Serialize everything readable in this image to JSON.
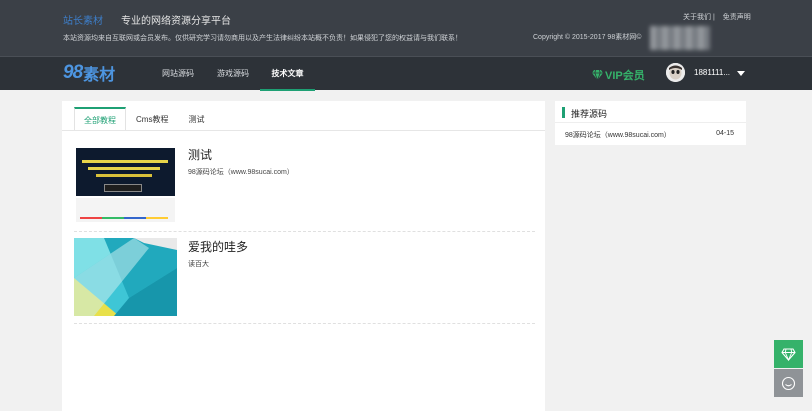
{
  "topbar": {
    "brand_mini": "站长素材",
    "slogan": "专业的网络资源分享平台",
    "notice": "本站资源均来自互联网或会员发布。仅供研究学习请勿商用以及产生法律纠纷本站概不负责！如果侵犯了您的权益请与我们联系！",
    "copyright": "Copyright © 2015-2017 98素材网©",
    "links": [
      "关于我们 |",
      "免责声明"
    ]
  },
  "nav": {
    "logo_num": "98",
    "logo_text": "素材",
    "items": [
      "网站源码",
      "游戏源码",
      "技术文章"
    ],
    "active_index": 2,
    "vip_label": "VIP会员",
    "username": "1881111..."
  },
  "tabs": [
    "全部教程",
    "Cms教程",
    "测试"
  ],
  "articles": [
    {
      "title": "测试",
      "desc": "98源码论坛（www.98sucai.com）"
    },
    {
      "title": "爱我的哇多",
      "desc": "读百大"
    }
  ],
  "sidebar": {
    "title": "推荐源码",
    "items": [
      {
        "title": "98源码论坛（www.98sucai.com）",
        "date": "04-15"
      }
    ]
  },
  "colors": {
    "accent": "#1ea074",
    "vip": "#35b26a",
    "topbar_bg": "#3b4047",
    "navbar_bg": "#2d3238",
    "logo": "#4d95e0"
  },
  "icons": {
    "vip": "diamond-icon",
    "service": "chat-icon",
    "user_menu": "caret-down-icon"
  }
}
